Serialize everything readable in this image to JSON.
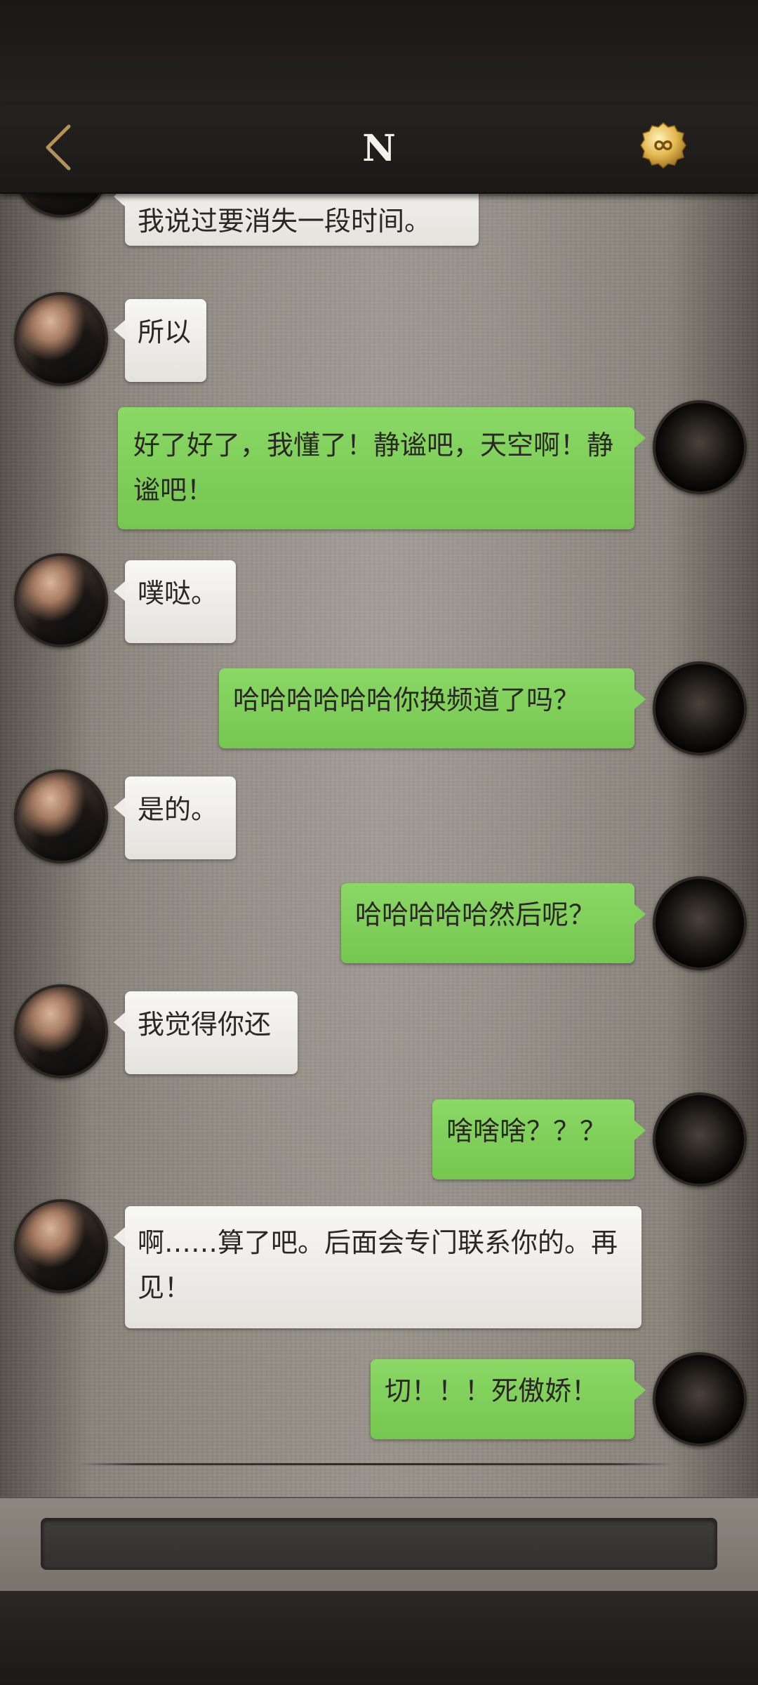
{
  "header": {
    "title": "N",
    "back_icon": "chevron-left-icon",
    "coin_icon": "infinity-coin-icon",
    "accent_color": "#c9a86a"
  },
  "messages": [
    {
      "side": "left",
      "text": "我说过要消失一段时间。"
    },
    {
      "side": "left",
      "text": "所以"
    },
    {
      "side": "right",
      "text": "好了好了，我懂了！静谧吧，天空啊！静谧吧！"
    },
    {
      "side": "left",
      "text": "噗哒。"
    },
    {
      "side": "right",
      "text": "哈哈哈哈哈哈你换频道了吗？"
    },
    {
      "side": "left",
      "text": "是的。"
    },
    {
      "side": "right",
      "text": "哈哈哈哈哈然后呢？"
    },
    {
      "side": "left",
      "text": "我觉得你还"
    },
    {
      "side": "right",
      "text": "啥啥啥？？？"
    },
    {
      "side": "left",
      "text": "啊……算了吧。后面会专门联系你的。再见！"
    },
    {
      "side": "right",
      "text": "切！！！死傲娇！"
    }
  ],
  "colors": {
    "outgoing_bubble": "#7fcf59",
    "incoming_bubble": "#efede9"
  }
}
